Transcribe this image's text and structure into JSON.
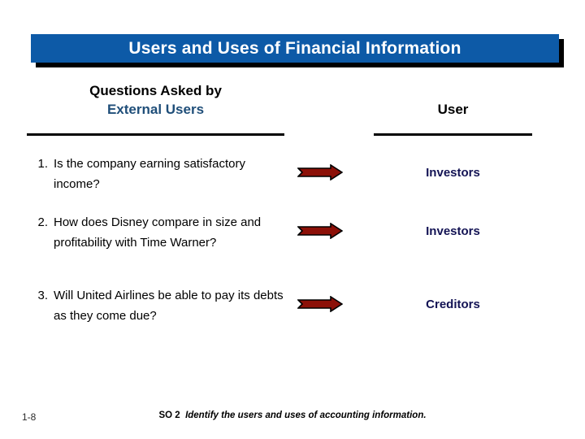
{
  "slide": {
    "title": "Users and Uses of Financial Information",
    "columns": {
      "left": {
        "line1": "Questions Asked by",
        "line2": "External Users"
      },
      "right": {
        "line1": "User"
      }
    },
    "rows": [
      {
        "number": "1.",
        "question": "Is the company earning satisfactory income?",
        "arrow": "right-arrow-icon",
        "user": "Investors"
      },
      {
        "number": "2.",
        "question": "How does Disney compare in size and profitability with Time Warner?",
        "arrow": "right-arrow-icon",
        "user": "Investors"
      },
      {
        "number": "3.",
        "question": "Will United Airlines be able to pay its debts as they come due?",
        "arrow": "right-arrow-icon",
        "user": "Creditors"
      }
    ],
    "footer": {
      "page_marker": "1-8",
      "objective_code": "SO 2",
      "objective_text": "Identify the users and uses of accounting information."
    },
    "colors": {
      "title_bar": "#0d5aa7",
      "title_text": "#ffffff",
      "header_accent": "#1f4e79",
      "user_label": "#131354",
      "arrow_fill": "#8c1008",
      "arrow_stroke": "#000000",
      "rule": "#000000"
    }
  }
}
